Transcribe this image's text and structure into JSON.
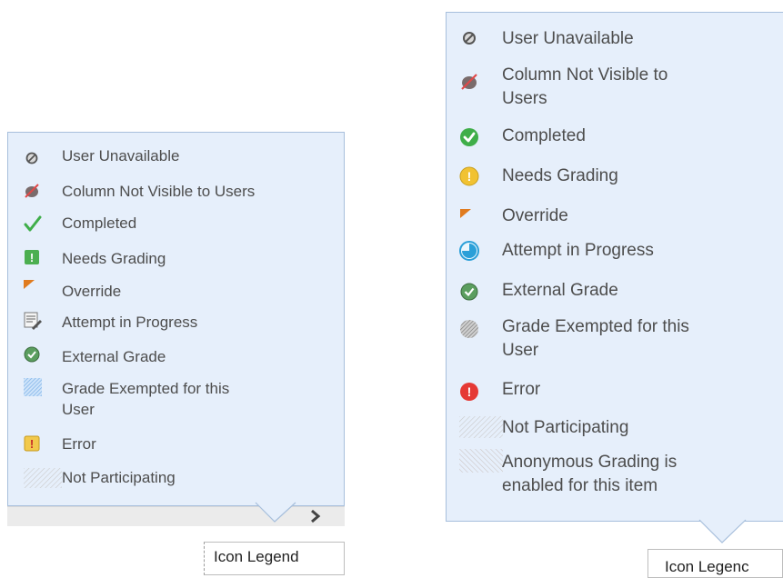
{
  "left_legend": {
    "items": [
      {
        "icon": "user-unavailable-icon",
        "label": "User Unavailable"
      },
      {
        "icon": "column-not-visible-icon",
        "label": "Column Not Visible to Users"
      },
      {
        "icon": "completed-checkmark-icon",
        "label": "Completed"
      },
      {
        "icon": "needs-grading-icon",
        "label": "Needs Grading"
      },
      {
        "icon": "override-icon",
        "label": "Override"
      },
      {
        "icon": "attempt-in-progress-icon",
        "label": "Attempt in Progress"
      },
      {
        "icon": "external-grade-icon",
        "label": "External Grade"
      },
      {
        "icon": "grade-exempted-icon",
        "label": "Grade Exempted for this",
        "label2": "User"
      },
      {
        "icon": "error-icon",
        "label": "Error"
      },
      {
        "icon": "not-participating-icon",
        "label": "Not Participating"
      }
    ],
    "button_label": "Icon Legend",
    "next_arrow": "›"
  },
  "right_legend": {
    "items": [
      {
        "icon": "user-unavailable-icon",
        "label": "User Unavailable"
      },
      {
        "icon": "column-not-visible-icon",
        "label": "Column Not Visible to",
        "label2": "Users"
      },
      {
        "icon": "completed-icon",
        "label": "Completed"
      },
      {
        "icon": "needs-grading-icon",
        "label": "Needs Grading"
      },
      {
        "icon": "override-icon",
        "label": "Override"
      },
      {
        "icon": "attempt-in-progress-icon",
        "label": "Attempt in Progress"
      },
      {
        "icon": "external-grade-icon",
        "label": "External Grade"
      },
      {
        "icon": "grade-exempted-icon",
        "label": "Grade Exempted for this",
        "label2": "User"
      },
      {
        "icon": "error-icon",
        "label": "Error"
      },
      {
        "icon": "not-participating-icon",
        "label": "Not Participating"
      },
      {
        "icon": "anonymous-grading-icon",
        "label": "Anonymous Grading is",
        "label2": "enabled for this item"
      }
    ],
    "button_label": "Icon Legenc"
  },
  "colors": {
    "panel_bg": "#e6effb",
    "panel_border": "#a7bfdc",
    "green": "#3fae49",
    "yellow": "#f1c232",
    "red": "#e53935",
    "orange": "#e07b1f",
    "blue": "#2a9fd8"
  }
}
